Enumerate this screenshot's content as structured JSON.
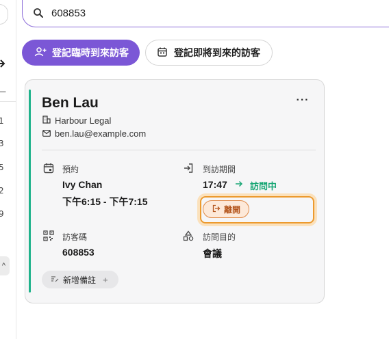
{
  "search": {
    "value": "608853",
    "placeholder": ""
  },
  "actions": {
    "walk_in_label": "登記臨時到來訪客",
    "upcoming_label": "登記即將到來的訪客"
  },
  "left_rail": {
    "glyphs": [
      "ㄧ",
      "1",
      "3",
      "5",
      "2",
      "9"
    ],
    "chip": "^"
  },
  "visitor_card": {
    "name": "Ben Lau",
    "company": "Harbour Legal",
    "email": "ben.lau@example.com",
    "appointment": {
      "label": "預約",
      "host": "Ivy Chan",
      "time": "下午6:15 - 下午7:15"
    },
    "visit_period": {
      "label": "到訪期間",
      "check_in_time": "17:47",
      "status": "訪問中",
      "leave_label": "離開"
    },
    "visitor_code": {
      "label": "訪客碼",
      "value": "608853"
    },
    "visit_purpose": {
      "label": "訪問目的",
      "value": "會議"
    },
    "add_note_label": "新增備註",
    "add_note_plus": "+",
    "more_label": "···"
  },
  "colors": {
    "accent_purple": "#7b57d6",
    "status_green": "#1aa776",
    "card_accent": "#20b38b",
    "leave_orange": "#b4561d",
    "focus_ring": "#ec9a2e"
  }
}
